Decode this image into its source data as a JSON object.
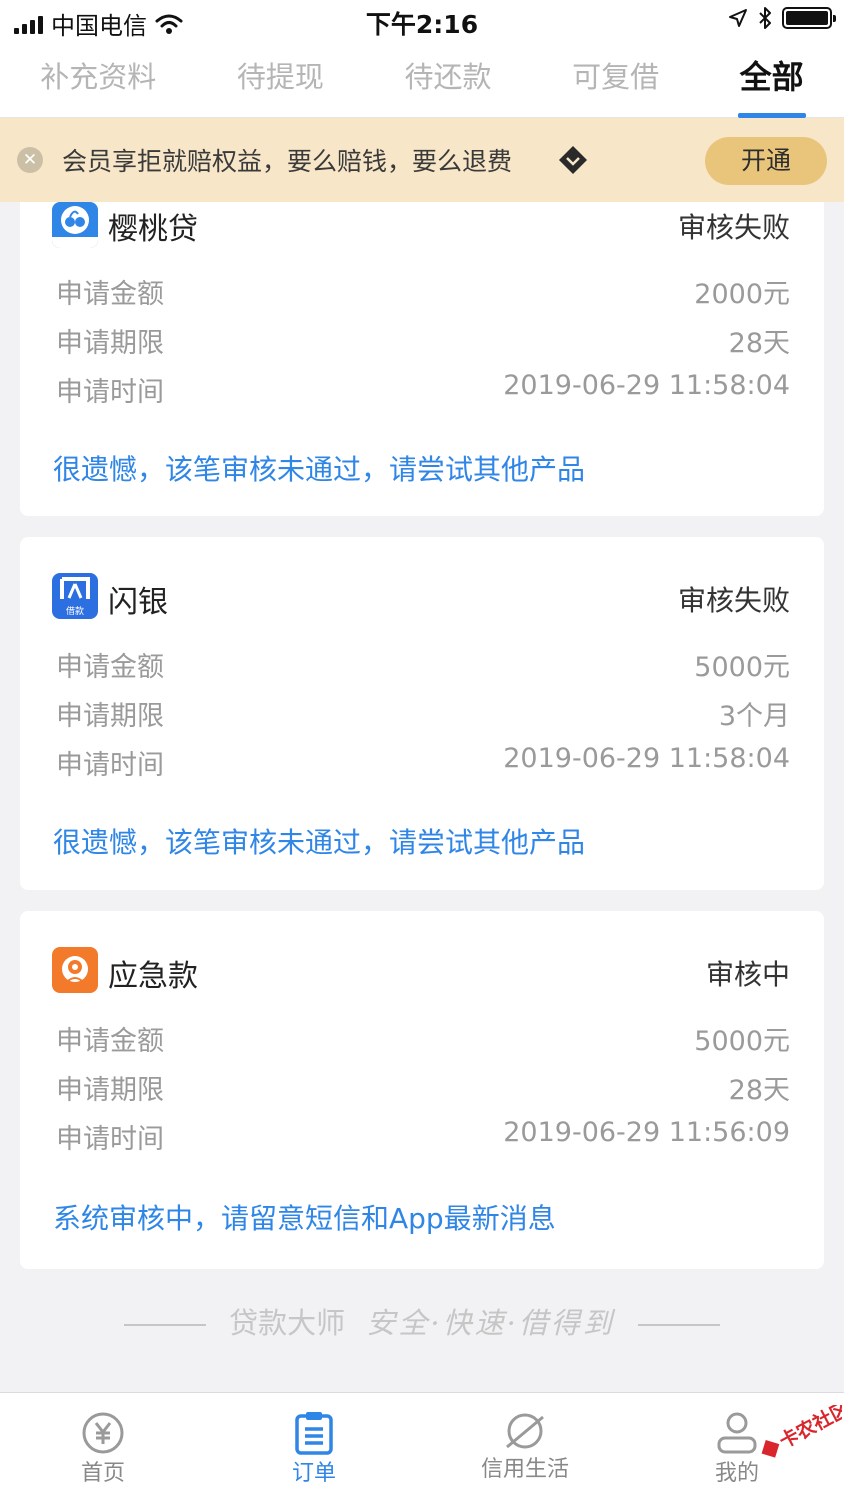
{
  "status_bar": {
    "carrier": "中国电信",
    "time": "下午2:16"
  },
  "tabs": [
    {
      "label": "补充资料",
      "active": false
    },
    {
      "label": "待提现",
      "active": false
    },
    {
      "label": "待还款",
      "active": false
    },
    {
      "label": "可复借",
      "active": false
    },
    {
      "label": "全部",
      "active": true
    }
  ],
  "banner": {
    "text": "会员享拒就赔权益，要么赔钱，要么退费",
    "button": "开通"
  },
  "row_labels": {
    "amount": "申请金额",
    "term": "申请期限",
    "time": "申请时间"
  },
  "orders": [
    {
      "product": "樱桃贷",
      "logo_text": "樱桃贷",
      "status": "审核失败",
      "amount": "2000元",
      "term": "28天",
      "time": "2019-06-29 11:58:04",
      "note": "很遗憾，该笔审核未通过，请尝试其他产品",
      "logo_color": "#2f86e6"
    },
    {
      "product": "闪银",
      "logo_text": "借款",
      "status": "审核失败",
      "amount": "5000元",
      "term": "3个月",
      "time": "2019-06-29 11:58:04",
      "note": "很遗憾，该笔审核未通过，请尝试其他产品",
      "logo_color": "#2c6fe0"
    },
    {
      "product": "应急款",
      "logo_text": "",
      "status": "审核中",
      "amount": "5000元",
      "term": "28天",
      "time": "2019-06-29 11:56:09",
      "note": "系统审核中，请留意短信和App最新消息",
      "logo_color": "#f47a2b"
    }
  ],
  "slogan": {
    "brand": "贷款大师",
    "tagline": "安全·快速·借得到"
  },
  "bottom_nav": [
    {
      "label": "首页",
      "icon": "yen-icon",
      "active": false
    },
    {
      "label": "订单",
      "icon": "clipboard-icon",
      "active": true
    },
    {
      "label": "信用生活",
      "icon": "planet-icon",
      "active": false
    },
    {
      "label": "我的",
      "icon": "user-icon",
      "active": false
    }
  ],
  "watermark": "卡农社区",
  "colors": {
    "accent": "#2f86e6",
    "banner_bg": "#f7e6c8",
    "button_gold": "#e9c47b"
  }
}
